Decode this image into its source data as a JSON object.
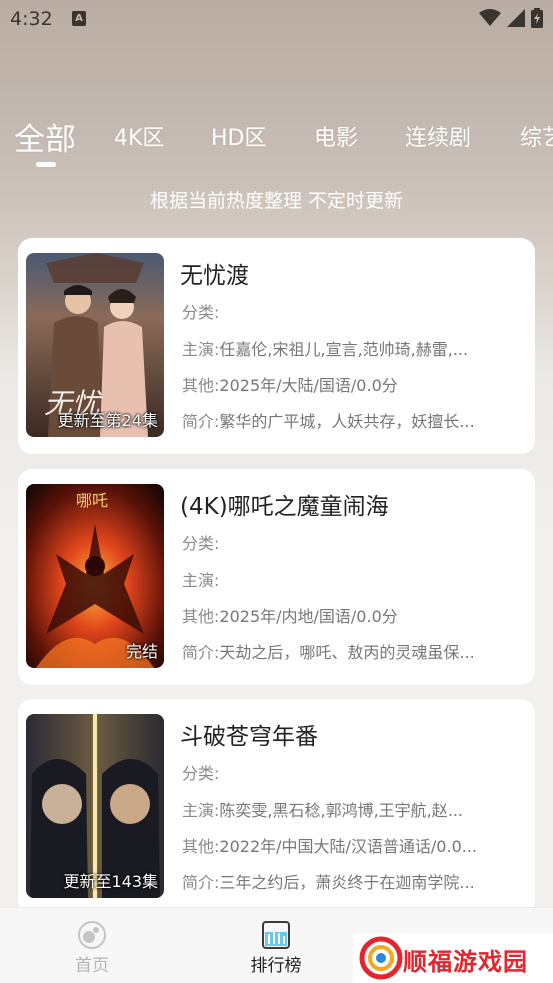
{
  "status_bar": {
    "time": "4:32",
    "notification_letter": "A",
    "icons": [
      "wifi-icon",
      "signal-icon",
      "battery-icon"
    ]
  },
  "tabs": [
    {
      "label": "全部",
      "active": true
    },
    {
      "label": "4K区",
      "active": false
    },
    {
      "label": "HD区",
      "active": false
    },
    {
      "label": "电影",
      "active": false
    },
    {
      "label": "连续剧",
      "active": false
    },
    {
      "label": "综艺",
      "active": false
    }
  ],
  "subtitle": "根据当前热度整理 不定时更新",
  "cards": [
    {
      "title": "无忧渡",
      "badge": "更新至第24集",
      "category_label": "分类:",
      "category": "",
      "cast_label": "主演:",
      "cast": "任嘉伦,宋祖儿,宣言,范帅琦,赫雷,...",
      "other_label": "其他:",
      "other": "2025年/大陆/国语/0.0分",
      "intro_label": "简介:",
      "intro": "繁华的广平城，人妖共存，妖擅长..."
    },
    {
      "title": "(4K)哪吒之魔童闹海",
      "badge": "完结",
      "category_label": "分类:",
      "category": "",
      "cast_label": "主演:",
      "cast": "",
      "other_label": "其他:",
      "other": "2025年/内地/国语/0.0分",
      "intro_label": "简介:",
      "intro": "天劫之后，哪吒、敖丙的灵魂虽保..."
    },
    {
      "title": "斗破苍穹年番",
      "badge": "更新至143集",
      "category_label": "分类:",
      "category": "",
      "cast_label": "主演:",
      "cast": "陈奕雯,黑石稔,郭鸿博,王宇航,赵...",
      "other_label": "其他:",
      "other": "2022年/中国大陆/汉语普通话/0.0...",
      "intro_label": "简介:",
      "intro": "三年之约后，萧炎终于在迦南学院..."
    }
  ],
  "bottom_nav": [
    {
      "label": "首页",
      "icon": "home-icon",
      "active": false
    },
    {
      "label": "排行榜",
      "icon": "ranking-icon",
      "active": true
    }
  ],
  "watermark": {
    "text": "顺福游戏园"
  },
  "colors": {
    "active_nav": "#222222",
    "inactive_nav": "#b5b5b5",
    "watermark_red": "#e3262e",
    "card_bg": "#ffffff"
  }
}
